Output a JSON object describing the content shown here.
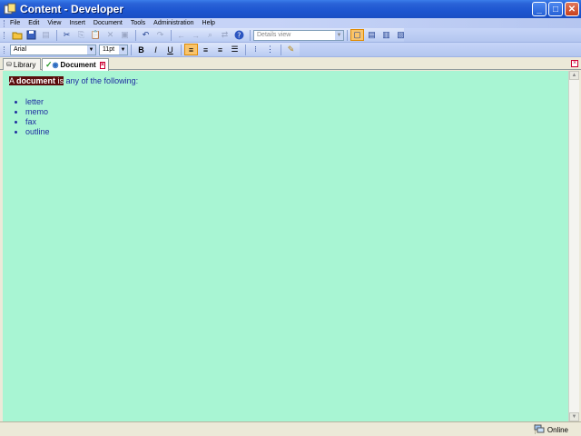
{
  "window": {
    "title": "Content - Developer",
    "minimize_label": "_",
    "maximize_label": "□",
    "close_label": "✕"
  },
  "menu": {
    "items": [
      "File",
      "Edit",
      "View",
      "Insert",
      "Document",
      "Tools",
      "Administration",
      "Help"
    ]
  },
  "toolbar1": {
    "view_combo": "Details view"
  },
  "toolbar2": {
    "font_combo": "Arial",
    "size_combo": "11pt",
    "bold_label": "B",
    "italic_label": "I",
    "underline_label": "U"
  },
  "tabs": [
    {
      "label": "Library"
    },
    {
      "label": "Document"
    }
  ],
  "document": {
    "sel_a": "A ",
    "sel_word": "document",
    "sel_is": " is",
    "rest": " any of the following:",
    "items": [
      "letter",
      "memo",
      "fax",
      "outline"
    ]
  },
  "status": {
    "connection": "Online"
  },
  "colors": {
    "content_bg": "#a8f5d3",
    "selection_bg": "#5a0d0d",
    "text": "#1f2da0"
  }
}
